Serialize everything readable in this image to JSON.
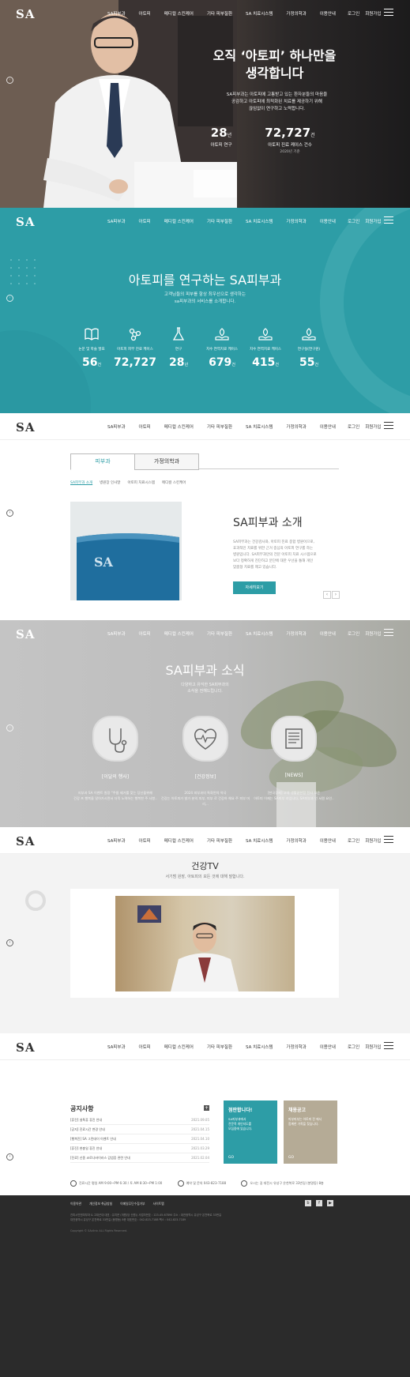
{
  "brand": {
    "logo": "SA",
    "teal": "#2d9da6"
  },
  "nav": {
    "items": [
      "SA피부과",
      "아토피",
      "메디컬 스킨케어",
      "기타 피부질환",
      "SA 치료시스템",
      "가정의학과",
      "이용안내"
    ],
    "login": "로그인",
    "join": "회원가입"
  },
  "hero": {
    "title_line1": "오직 ‘아토피’ 하나만을",
    "title_line2": "생각합니다",
    "desc_line1": "SA피부과는 아토피에 고통받고 있는 환자분들의 마음을",
    "desc_line2": "공감하고 아토피에 최적화된 치료를 제공하기 위해",
    "desc_line3": "끊임없이 연구하고 노력합니다.",
    "stat1": {
      "value": "28",
      "unit": "년",
      "label": "아토피 연구"
    },
    "stat2": {
      "value": "72,727",
      "unit": "건",
      "label": "아토피 진료 케이스 건수",
      "note": "2020년 기준"
    }
  },
  "research": {
    "title": "아토피를 연구하는 SA피부과",
    "desc_line1": "고객님들의 피부를 항상 최우선으로 생각하는",
    "desc_line2": "sa피부과의 서비스를 소개합니다.",
    "stats": [
      {
        "label": "논문 및 학술 발표",
        "value": "56",
        "unit": "건",
        "icon": "book-icon"
      },
      {
        "label": "아토피 피부 진료 케이스",
        "value": "72,727",
        "unit": "",
        "icon": "molecule-icon"
      },
      {
        "label": "연구",
        "value": "28",
        "unit": "년",
        "icon": "flask-icon"
      },
      {
        "label": "치수 연역치료 케이스",
        "value": "679",
        "unit": "건",
        "icon": "leaf-hand-icon"
      },
      {
        "label": "치수 연역치료 케이스",
        "value": "415",
        "unit": "건",
        "icon": "leaf-hand-icon"
      },
      {
        "label": "연구실(연구원)",
        "value": "55",
        "unit": "건",
        "icon": "leaf-hand-icon"
      }
    ]
  },
  "about": {
    "tab1": "피부과",
    "tab2": "가정의학과",
    "subtabs": [
      "SA피부과 소개",
      "병원장 인사말",
      "아토피 치료시스템",
      "메디컬 스킨케어"
    ],
    "title": "SA피부과 소개",
    "desc_line1": "SA피부과는 건강검사와, 아토피 진료 종합 병원이므로,",
    "desc_line2": "효과적인 치료를 위한 근거 중심의 아토피 연구를 하는",
    "desc_line3": "병원입니다. SA피부과만의 전문 아토피 치료 시스템으로",
    "desc_line4": "보다 정확하게 진단하고 분단에 대한 우선을 통해 개인",
    "desc_line5": "맞춤형 치료를 제고 있습니다.",
    "button": "자세히보기"
  },
  "news": {
    "title": "SA피부과 소식",
    "desc_line1": "다양하고 유익한 SA피부과의",
    "desc_line2": "소식을 전해드립니다.",
    "items": [
      {
        "icon": "stethoscope-icon",
        "caption": "[이달의 행사]",
        "text1": "피부과 SA 이벤트 원장 \"주름 제거를 찾는 당신을위해",
        "text2": "건강 프 행복을 알아가시면서 더욱 노력하는 행복한 주 사항.."
      },
      {
        "icon": "heart-pulse-icon",
        "caption": "[건강정보]",
        "text1": "2024 피부과의 특화된의 약국",
        "text2": "건강는 아토피가 발가 분의 피부, 피부 로 건강하 해요 주 피부 머리,.."
      },
      {
        "icon": "newspaper-icon",
        "caption": "[NEWS]",
        "text1": "[한국경제] 고대 생활끝한함 전사 모든",
        "text2": "아토피 이제는 SA피부 과입니다, SA피부과 인 서원 요인.."
      }
    ]
  },
  "tv": {
    "title": "건강TV",
    "desc": "서기범 원장, 아토피의 모든 것에 대해 말합니다."
  },
  "notice": {
    "title": "공지사항",
    "rows": [
      {
        "title": "[휴진] 설특휴 휴진 안내",
        "date": "2021.09.05"
      },
      {
        "title": "[공지] 진료시간 변경 안내",
        "date": "2021.04.15"
      },
      {
        "title": "[행복진] SA 그린데이 이벤트 안내",
        "date": "2021.04.10"
      },
      {
        "title": "[휴진] 현충일 휴진 안내",
        "date": "2021.03.29"
      },
      {
        "title": "[진료] 신종 코로나바이러스 감염증 관련 안내",
        "date": "2021.02.04"
      }
    ],
    "card1": {
      "title": "점판합니다!",
      "line1": "SA피부과에서",
      "line2": "전문적 개인지도를",
      "line3": "모집중에 있습니다.",
      "go": "GO"
    },
    "card2": {
      "title": "채용공고",
      "line1": "피부피부는 아토피 전 에서",
      "line2": "함께한 가족을 찾습니다.",
      "line3": "",
      "go": "GO"
    },
    "contact1": "진료시간 평일 AM 9:00~PM 6:30 / 토 AM 8:30~PM 1:00",
    "contact2": "예약 및 문의 043-823-7188",
    "contact3": "오시는 길 대전시 유성구 온천북로 33번길 (봉명동) 8층"
  },
  "footer": {
    "links": [
      "이용약관",
      "개인정보 취급방침",
      "이메일무단수집거부",
      "사이트맵"
    ],
    "info1": "진피시민앤피부과 & 고대곤대 대표 : 유지운 (개원(당 신원)) 사업자번호 : 123-45-67890 주소 : 대전광역시 유성구 온천북로 33번길",
    "info2": "대전광역시 유성구 온천북로 33번길 (봉명동) 8층  대표번호 : 042-823-7188  팩스 : 042-823-7189",
    "copyright": "Copyright © SAclinic ALL Rights Reserved."
  }
}
